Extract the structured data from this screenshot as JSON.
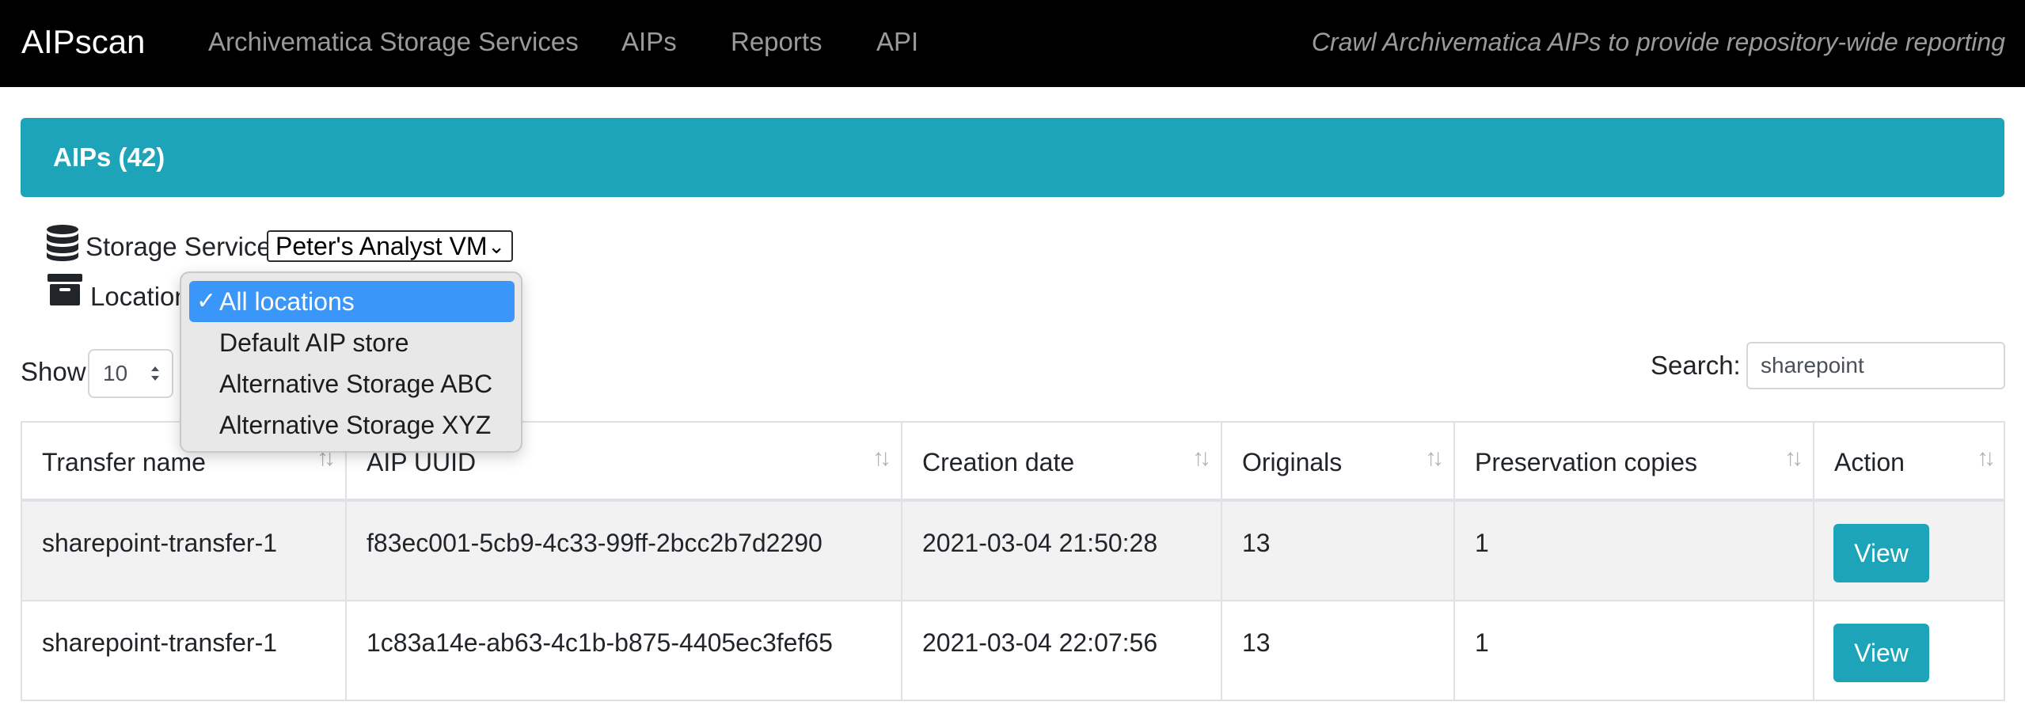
{
  "navbar": {
    "brand": "AIPscan",
    "links": [
      "Archivematica Storage Services",
      "AIPs",
      "Reports",
      "API"
    ],
    "tagline": "Crawl Archivematica AIPs to provide repository-wide reporting"
  },
  "header": {
    "title": "AIPs (42)"
  },
  "filters": {
    "storage_service_label": "Storage Service",
    "storage_service_value": "Peter's Analyst VM",
    "location_label": "Location"
  },
  "location_dropdown": {
    "options": [
      "All locations",
      "Default AIP store",
      "Alternative Storage ABC",
      "Alternative Storage XYZ"
    ],
    "selected_index": 0,
    "check_glyph": "✓"
  },
  "show": {
    "label": "Show",
    "value": "10"
  },
  "search": {
    "label": "Search:",
    "value": "sharepoint"
  },
  "table": {
    "columns": [
      "Transfer name",
      "AIP UUID",
      "Creation date",
      "Originals",
      "Preservation copies",
      "Action"
    ],
    "rows": [
      {
        "transfer_name": "sharepoint-transfer-1",
        "aip_uuid": "f83ec001-5cb9-4c33-99ff-2bcc2b7d2290",
        "creation_date": "2021-03-04 21:50:28",
        "originals": "13",
        "preservation_copies": "1",
        "action": "View"
      },
      {
        "transfer_name": "sharepoint-transfer-1",
        "aip_uuid": "1c83a14e-ab63-4c1b-b875-4405ec3fef65",
        "creation_date": "2021-03-04 22:07:56",
        "originals": "13",
        "preservation_copies": "1",
        "action": "View"
      }
    ]
  },
  "colors": {
    "navbar_bg": "#000000",
    "accent": "#1ea4b8",
    "selection": "#3a96f8"
  },
  "icons": [
    "database-icon",
    "archive-icon",
    "sort-icon",
    "chevron-down-icon",
    "select-arrows-icon",
    "checkmark-icon"
  ]
}
